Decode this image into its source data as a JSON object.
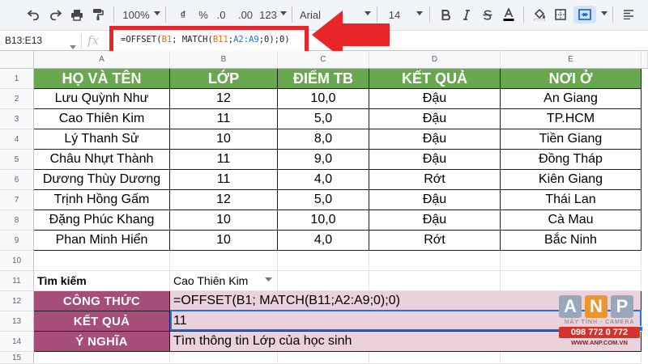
{
  "toolbar": {
    "zoom": "100%",
    "currency": "₫",
    "percent": "%",
    "dec_less": ".0",
    "dec_more": ".00",
    "more_formats": "123",
    "font": "Arial",
    "font_size": "14",
    "icons": [
      "undo-icon",
      "redo-icon",
      "print-icon",
      "paint-format-icon",
      "bold-icon",
      "italic-icon",
      "strikethrough-icon",
      "text-color-icon",
      "fill-color-icon",
      "borders-icon",
      "merge-cells-icon",
      "align-icon"
    ]
  },
  "formula_bar": {
    "name_box": "B13:E13",
    "fx": "fx",
    "formula_parts": [
      {
        "text": "=OFFSET(",
        "tok": ""
      },
      {
        "text": "B1",
        "tok": "1"
      },
      {
        "text": "; MATCH(",
        "tok": ""
      },
      {
        "text": "B11",
        "tok": "1"
      },
      {
        "text": ";",
        "tok": ""
      },
      {
        "text": "A2:A9",
        "tok": "2"
      },
      {
        "text": ";0);0)",
        "tok": ""
      }
    ]
  },
  "columns": [
    "A",
    "B",
    "C",
    "D",
    "E"
  ],
  "rows": [
    "1",
    "2",
    "3",
    "4",
    "5",
    "6",
    "7",
    "8",
    "9",
    "10",
    "11",
    "12",
    "13",
    "14",
    "15"
  ],
  "table": {
    "headers": [
      "HỌ VÀ TÊN",
      "LỚP",
      "ĐIỂM TB",
      "KẾT QUẢ",
      "NƠI Ở"
    ],
    "rows": [
      [
        "Lưu Quỳnh Như",
        "12",
        "10,0",
        "Đậu",
        "An Giang"
      ],
      [
        "Cao Thiên Kim",
        "11",
        "5,0",
        "Đậu",
        "TP.HCM"
      ],
      [
        "Lý Thanh Sử",
        "10",
        "8,0",
        "Đậu",
        "Tiền Giang"
      ],
      [
        "Châu Nhựt Thành",
        "11",
        "9,0",
        "Đậu",
        "Đồng Tháp"
      ],
      [
        "Dương Thùy Dương",
        "11",
        "4,0",
        "Rớt",
        "Kiên Giang"
      ],
      [
        "Trịnh Hồng Gấm",
        "12",
        "5,0",
        "Đậu",
        "Thái Lan"
      ],
      [
        "Đặng Phúc Khang",
        "10",
        "10,0",
        "Đậu",
        "Cà Mau"
      ],
      [
        "Phan Minh Hiển",
        "10",
        "4,0",
        "Rớt",
        "Bắc Ninh"
      ]
    ]
  },
  "lookup": {
    "search_label": "Tìm kiếm",
    "search_value": "Cao Thiên Kim",
    "formula_label": "CÔNG THỨC",
    "formula_value": "=OFFSET(B1; MATCH(B11;A2:A9;0);0)",
    "result_label": "KẾT QUẢ",
    "result_value": "11",
    "meaning_label": "Ý NGHĨA",
    "meaning_value": "Tìm thông tin Lớp của học sinh"
  },
  "watermark": {
    "letters": [
      "A",
      "N",
      "P"
    ],
    "tagline": "MÁY TÍNH - CAMERA",
    "phone": "098 772 0 772",
    "website": "WWW.ANP.COM.VN"
  },
  "colors": {
    "header_green": "#6aa84f",
    "label_purple": "#a64d79",
    "value_pink": "#ead1dc",
    "highlight_red": "#e8262a",
    "selection_blue": "#1a73e8"
  }
}
